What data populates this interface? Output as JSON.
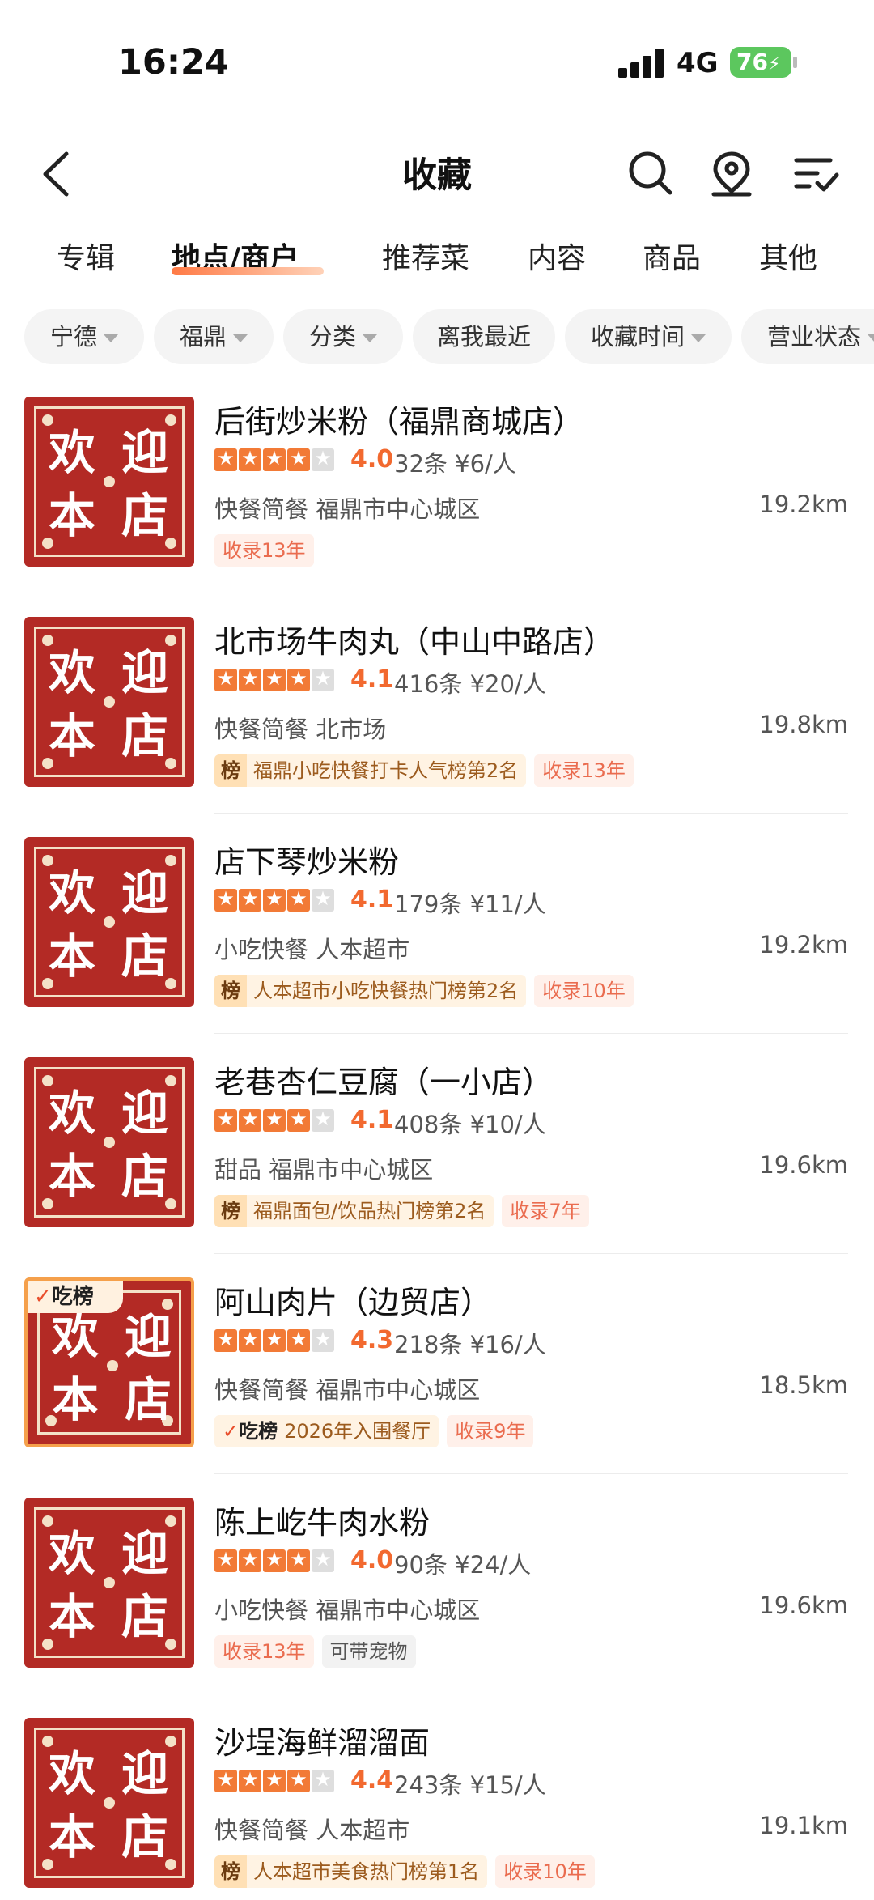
{
  "status_bar": {
    "time": "16:24",
    "network": "4G",
    "battery": "76"
  },
  "header": {
    "title": "收藏"
  },
  "tabs": [
    {
      "label": "专辑"
    },
    {
      "label": "地点/商户"
    },
    {
      "label": "推荐菜"
    },
    {
      "label": "内容"
    },
    {
      "label": "商品"
    },
    {
      "label": "其他"
    }
  ],
  "active_tab": "地点/商户",
  "filters": [
    {
      "label": "宁德"
    },
    {
      "label": "福鼎"
    },
    {
      "label": "分类"
    },
    {
      "label": "离我最近"
    },
    {
      "label": "收藏时间"
    },
    {
      "label": "营业状态"
    }
  ],
  "thumb_text": {
    "c1": "欢",
    "c2": "迎",
    "c3": "本",
    "c4": "店"
  },
  "eat_badge": "吃榜",
  "items": [
    {
      "name": "后街炒米粉（福鼎商城店）",
      "rating": 4,
      "score": "4.0",
      "meta": "32条 ¥6/人",
      "category": "快餐简餐 福鼎市中心城区",
      "distance": "19.2km",
      "rank_label": "",
      "rank": "",
      "tag1": "收录13年",
      "tag2": ""
    },
    {
      "name": "北市场牛肉丸（中山中路店）",
      "rating": 4,
      "score": "4.1",
      "meta": "416条 ¥20/人",
      "category": "快餐简餐 北市场",
      "distance": "19.8km",
      "rank_label": "榜",
      "rank": "福鼎小吃快餐打卡人气榜第2名",
      "tag1": "收录13年",
      "tag2": ""
    },
    {
      "name": "店下琴炒米粉",
      "rating": 4,
      "score": "4.1",
      "meta": "179条 ¥11/人",
      "category": "小吃快餐 人本超市",
      "distance": "19.2km",
      "rank_label": "榜",
      "rank": "人本超市小吃快餐热门榜第2名",
      "tag1": "收录10年",
      "tag2": ""
    },
    {
      "name": "老巷杏仁豆腐（一小店）",
      "rating": 4,
      "score": "4.1",
      "meta": "408条 ¥10/人",
      "category": "甜品 福鼎市中心城区",
      "distance": "19.6km",
      "rank_label": "榜",
      "rank": "福鼎面包/饮品热门榜第2名",
      "tag1": "收录7年",
      "tag2": ""
    },
    {
      "name": "阿山肉片（边贸店）",
      "rating": 4,
      "score": "4.3",
      "meta": "218条 ¥16/人",
      "category": "快餐简餐 福鼎市中心城区",
      "distance": "18.5km",
      "rank_label": "吃榜",
      "rank": "2026年入围餐厅",
      "tag1": "收录9年",
      "tag2": ""
    },
    {
      "name": "陈上屹牛肉水粉",
      "rating": 4,
      "score": "4.0",
      "meta": "90条 ¥24/人",
      "category": "小吃快餐 福鼎市中心城区",
      "distance": "19.6km",
      "rank_label": "",
      "rank": "",
      "tag1": "收录13年",
      "tag2": "可带宠物"
    },
    {
      "name": "沙埕海鲜溜溜面",
      "rating": 4,
      "score": "4.4",
      "meta": "243条 ¥15/人",
      "category": "快餐简餐 人本超市",
      "distance": "19.1km",
      "rank_label": "榜",
      "rank": "人本超市美食热门榜第1名",
      "tag1": "收录10年",
      "tag2": ""
    }
  ],
  "colors": {
    "accent": "#f2692f",
    "thumb_bg": "#b32a25",
    "battery": "#5cc75e"
  }
}
